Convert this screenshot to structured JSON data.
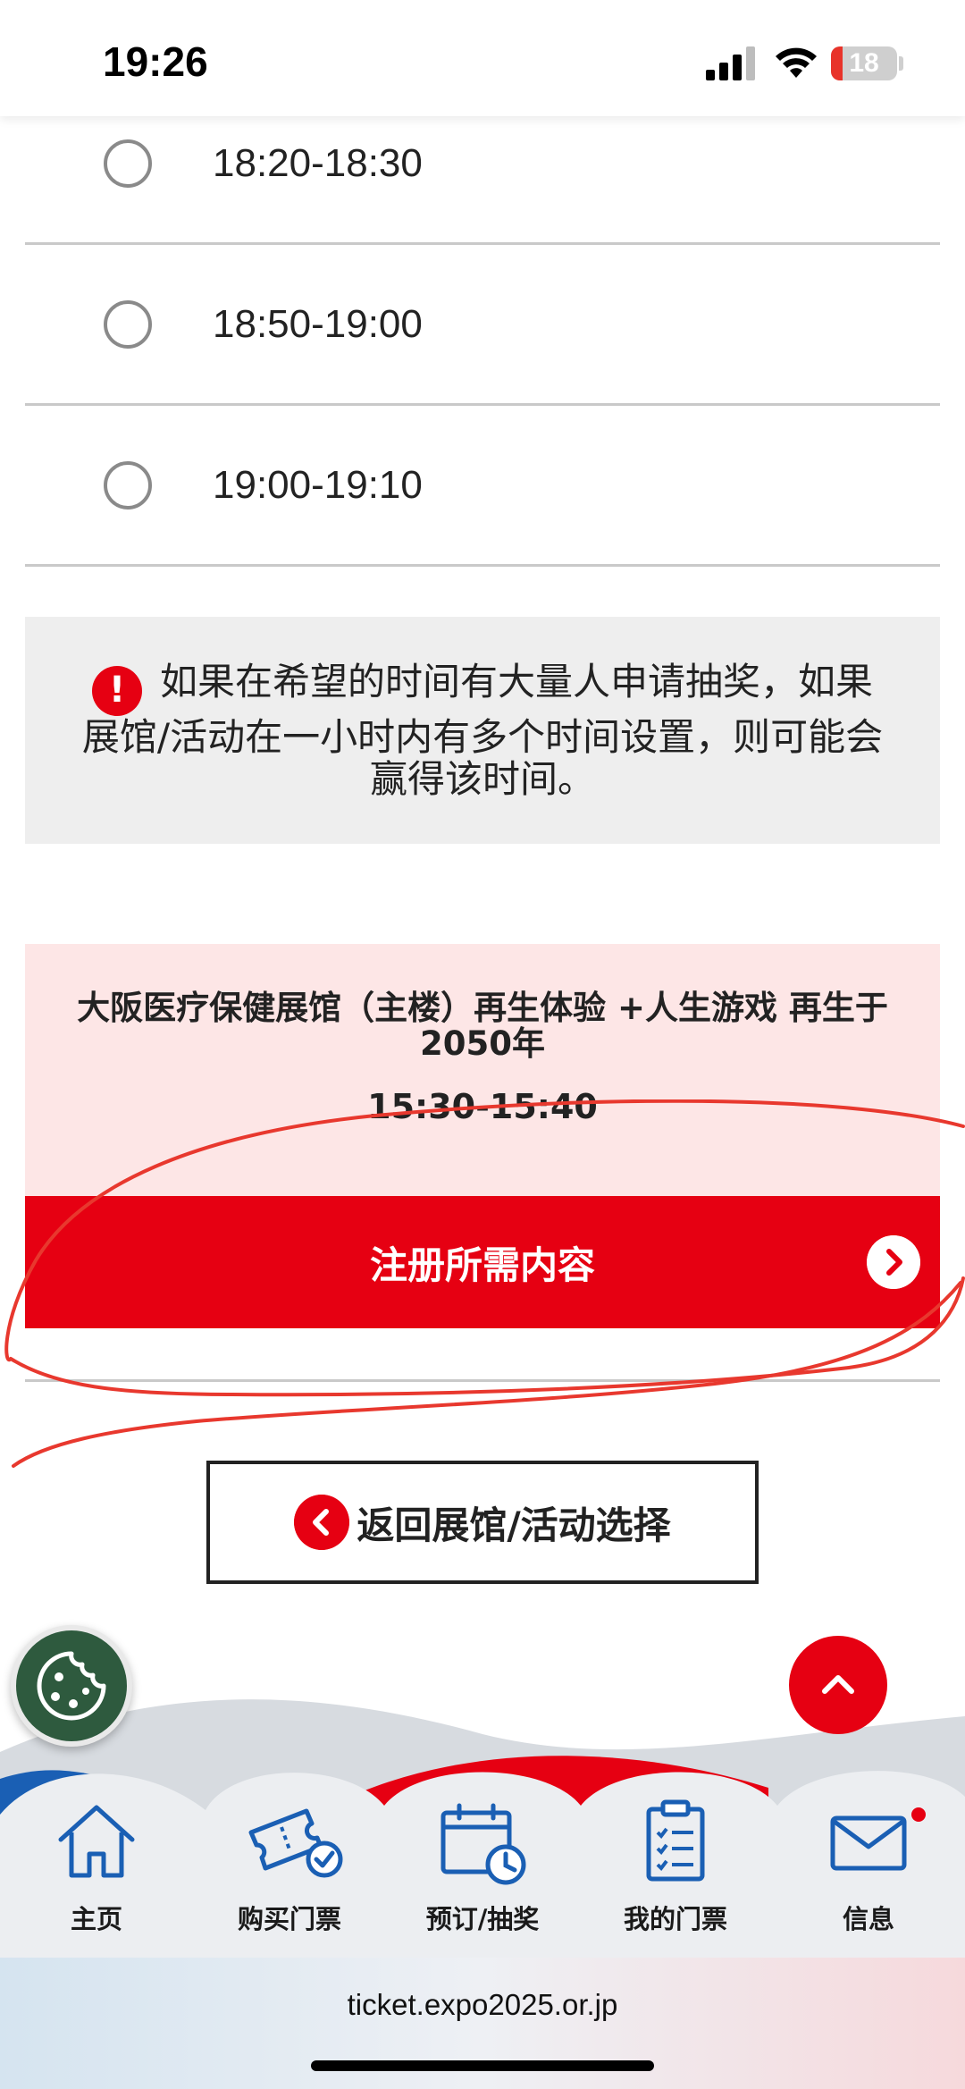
{
  "status_bar": {
    "time": "19:26",
    "battery": "18",
    "battery_level": 0.18
  },
  "time_slots": [
    {
      "label": "18:20-18:30",
      "selected": false
    },
    {
      "label": "18:50-19:00",
      "selected": false
    },
    {
      "label": "19:00-19:10",
      "selected": false
    }
  ],
  "notice": {
    "icon": "alert-icon",
    "text": "如果在希望的时间有大量人申请抽奖，如果展馆/活动在一小时内有多个时间设置，则可能会赢得该时间。"
  },
  "selected_card": {
    "pavilion_name": "大阪医疗保健展馆（主楼）再生体验 +人生游戏 再生于2050年",
    "time": "15:30-15:40"
  },
  "register_button": {
    "label": "注册所需内容"
  },
  "back_button": {
    "label": "返回展馆/活动选择"
  },
  "bottom_nav": [
    {
      "label": "主页",
      "icon": "home-icon"
    },
    {
      "label": "购买门票",
      "icon": "ticket-check-icon"
    },
    {
      "label": "预订/抽奖",
      "icon": "calendar-clock-icon"
    },
    {
      "label": "我的门票",
      "icon": "clipboard-icon"
    },
    {
      "label": "信息",
      "icon": "mail-icon"
    }
  ],
  "url": "ticket.expo2025.or.jp",
  "colors": {
    "accent": "#e60012",
    "notice_bg": "#eeeeee",
    "card_bg": "#fde6e6",
    "cookie": "#2e5a3e"
  }
}
